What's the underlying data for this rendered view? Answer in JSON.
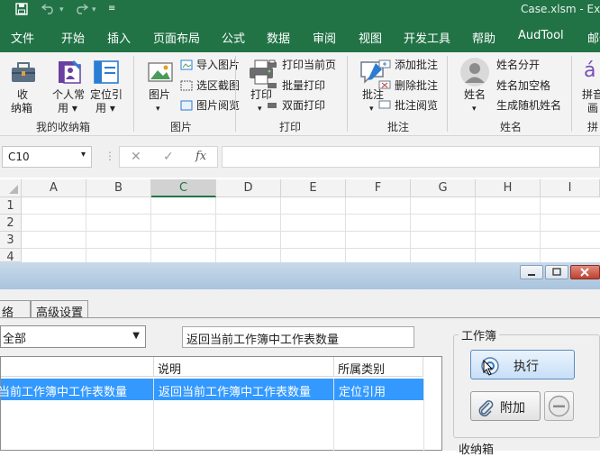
{
  "colors": {
    "excel_green": "#217346",
    "selection_blue": "#3399ff",
    "accent_select": "#1e7145"
  },
  "app": {
    "window_title": "Case.xlsm  -  Ex"
  },
  "qat": {
    "save_icon": "save-icon",
    "undo_icon": "undo-icon",
    "redo_icon": "redo-icon",
    "customize_icon": "chevron-down-icon"
  },
  "menu": {
    "tabs": [
      "文件",
      "开始",
      "插入",
      "页面布局",
      "公式",
      "数据",
      "审阅",
      "视图",
      "开发工具",
      "帮助",
      "AudTool",
      "邮件"
    ]
  },
  "ribbon": {
    "collect": {
      "btn1_line1": "收",
      "btn1_line2": "纳箱",
      "btn2_line1": "个人常",
      "btn2_line2": "用 ▾",
      "btn3_line1": "定位引",
      "btn3_line2": "用 ▾",
      "group": "我的收纳箱"
    },
    "picture": {
      "big_label": "图片",
      "big_arrow": "▾",
      "small1": "导入图片",
      "small2": "选区截图",
      "small3": "图片阅览",
      "group": "图片"
    },
    "print": {
      "big_label": "打印",
      "big_arrow": "▾",
      "small1": "打印当前页",
      "small2": "批量打印",
      "small3": "双面打印",
      "group": "打印"
    },
    "comment": {
      "big_label": "批注",
      "big_arrow": "▾",
      "small1": "添加批注",
      "small2": "删除批注",
      "small3": "批注阅览",
      "group": "批注"
    },
    "name": {
      "big_label": "姓名",
      "big_arrow": "▾",
      "small1": "姓名分开",
      "small2": "姓名加空格",
      "small3": "生成随机姓名",
      "group": "姓名"
    },
    "pinyin": {
      "big_label_line1": "拼音",
      "big_label_line2": "画",
      "group": "拼"
    }
  },
  "formula_bar": {
    "name_box": "C10",
    "name_box_arrow": "▾",
    "cancel": "✕",
    "confirm": "✓",
    "fx": "fx",
    "value": ""
  },
  "grid": {
    "columns": [
      "A",
      "B",
      "C",
      "D",
      "E",
      "F",
      "G",
      "H",
      "I"
    ],
    "rows": [
      "1",
      "2",
      "3",
      "4"
    ]
  },
  "dialog": {
    "tabs": [
      "络",
      "高级设置"
    ],
    "category_value": "全部",
    "description_value": "返回当前工作簿中工作表数量",
    "list": {
      "headers": [
        "说明",
        "所属类别"
      ],
      "rows": [
        {
          "name": "当前工作簿中工作表数量",
          "desc": "返回当前工作簿中工作表数量",
          "category": "定位引用"
        }
      ]
    },
    "workbook_group": {
      "label": "工作簿",
      "execute": "执行",
      "attach": "附加"
    },
    "collect_label": "收纳箱"
  }
}
